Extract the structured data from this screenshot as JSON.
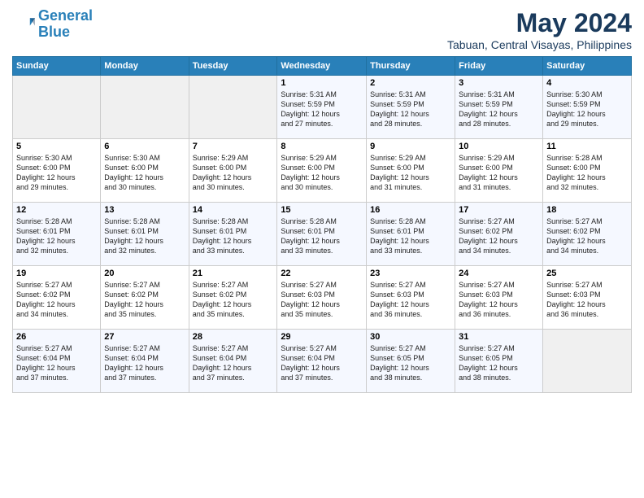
{
  "logo": {
    "line1": "General",
    "line2": "Blue"
  },
  "title": "May 2024",
  "location": "Tabuan, Central Visayas, Philippines",
  "days_of_week": [
    "Sunday",
    "Monday",
    "Tuesday",
    "Wednesday",
    "Thursday",
    "Friday",
    "Saturday"
  ],
  "weeks": [
    [
      {
        "day": "",
        "info": ""
      },
      {
        "day": "",
        "info": ""
      },
      {
        "day": "",
        "info": ""
      },
      {
        "day": "1",
        "info": "Sunrise: 5:31 AM\nSunset: 5:59 PM\nDaylight: 12 hours\nand 27 minutes."
      },
      {
        "day": "2",
        "info": "Sunrise: 5:31 AM\nSunset: 5:59 PM\nDaylight: 12 hours\nand 28 minutes."
      },
      {
        "day": "3",
        "info": "Sunrise: 5:31 AM\nSunset: 5:59 PM\nDaylight: 12 hours\nand 28 minutes."
      },
      {
        "day": "4",
        "info": "Sunrise: 5:30 AM\nSunset: 5:59 PM\nDaylight: 12 hours\nand 29 minutes."
      }
    ],
    [
      {
        "day": "5",
        "info": "Sunrise: 5:30 AM\nSunset: 6:00 PM\nDaylight: 12 hours\nand 29 minutes."
      },
      {
        "day": "6",
        "info": "Sunrise: 5:30 AM\nSunset: 6:00 PM\nDaylight: 12 hours\nand 30 minutes."
      },
      {
        "day": "7",
        "info": "Sunrise: 5:29 AM\nSunset: 6:00 PM\nDaylight: 12 hours\nand 30 minutes."
      },
      {
        "day": "8",
        "info": "Sunrise: 5:29 AM\nSunset: 6:00 PM\nDaylight: 12 hours\nand 30 minutes."
      },
      {
        "day": "9",
        "info": "Sunrise: 5:29 AM\nSunset: 6:00 PM\nDaylight: 12 hours\nand 31 minutes."
      },
      {
        "day": "10",
        "info": "Sunrise: 5:29 AM\nSunset: 6:00 PM\nDaylight: 12 hours\nand 31 minutes."
      },
      {
        "day": "11",
        "info": "Sunrise: 5:28 AM\nSunset: 6:00 PM\nDaylight: 12 hours\nand 32 minutes."
      }
    ],
    [
      {
        "day": "12",
        "info": "Sunrise: 5:28 AM\nSunset: 6:01 PM\nDaylight: 12 hours\nand 32 minutes."
      },
      {
        "day": "13",
        "info": "Sunrise: 5:28 AM\nSunset: 6:01 PM\nDaylight: 12 hours\nand 32 minutes."
      },
      {
        "day": "14",
        "info": "Sunrise: 5:28 AM\nSunset: 6:01 PM\nDaylight: 12 hours\nand 33 minutes."
      },
      {
        "day": "15",
        "info": "Sunrise: 5:28 AM\nSunset: 6:01 PM\nDaylight: 12 hours\nand 33 minutes."
      },
      {
        "day": "16",
        "info": "Sunrise: 5:28 AM\nSunset: 6:01 PM\nDaylight: 12 hours\nand 33 minutes."
      },
      {
        "day": "17",
        "info": "Sunrise: 5:27 AM\nSunset: 6:02 PM\nDaylight: 12 hours\nand 34 minutes."
      },
      {
        "day": "18",
        "info": "Sunrise: 5:27 AM\nSunset: 6:02 PM\nDaylight: 12 hours\nand 34 minutes."
      }
    ],
    [
      {
        "day": "19",
        "info": "Sunrise: 5:27 AM\nSunset: 6:02 PM\nDaylight: 12 hours\nand 34 minutes."
      },
      {
        "day": "20",
        "info": "Sunrise: 5:27 AM\nSunset: 6:02 PM\nDaylight: 12 hours\nand 35 minutes."
      },
      {
        "day": "21",
        "info": "Sunrise: 5:27 AM\nSunset: 6:02 PM\nDaylight: 12 hours\nand 35 minutes."
      },
      {
        "day": "22",
        "info": "Sunrise: 5:27 AM\nSunset: 6:03 PM\nDaylight: 12 hours\nand 35 minutes."
      },
      {
        "day": "23",
        "info": "Sunrise: 5:27 AM\nSunset: 6:03 PM\nDaylight: 12 hours\nand 36 minutes."
      },
      {
        "day": "24",
        "info": "Sunrise: 5:27 AM\nSunset: 6:03 PM\nDaylight: 12 hours\nand 36 minutes."
      },
      {
        "day": "25",
        "info": "Sunrise: 5:27 AM\nSunset: 6:03 PM\nDaylight: 12 hours\nand 36 minutes."
      }
    ],
    [
      {
        "day": "26",
        "info": "Sunrise: 5:27 AM\nSunset: 6:04 PM\nDaylight: 12 hours\nand 37 minutes."
      },
      {
        "day": "27",
        "info": "Sunrise: 5:27 AM\nSunset: 6:04 PM\nDaylight: 12 hours\nand 37 minutes."
      },
      {
        "day": "28",
        "info": "Sunrise: 5:27 AM\nSunset: 6:04 PM\nDaylight: 12 hours\nand 37 minutes."
      },
      {
        "day": "29",
        "info": "Sunrise: 5:27 AM\nSunset: 6:04 PM\nDaylight: 12 hours\nand 37 minutes."
      },
      {
        "day": "30",
        "info": "Sunrise: 5:27 AM\nSunset: 6:05 PM\nDaylight: 12 hours\nand 38 minutes."
      },
      {
        "day": "31",
        "info": "Sunrise: 5:27 AM\nSunset: 6:05 PM\nDaylight: 12 hours\nand 38 minutes."
      },
      {
        "day": "",
        "info": ""
      }
    ]
  ]
}
